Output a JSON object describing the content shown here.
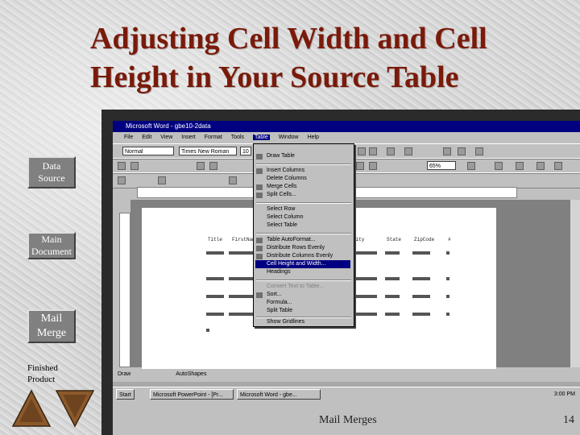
{
  "slide": {
    "title_line1": "Adjusting Cell Width and Cell",
    "title_line2": "Height in Your Source Table",
    "footer": "Mail Merges",
    "page_number": "14"
  },
  "nav": {
    "data_source": "Data Source",
    "main_document": "Main Document",
    "mail_merge": "Mail Merge",
    "finished_product": "Finished Product"
  },
  "word": {
    "window_title": "Microsoft Word - gbe10-2data",
    "menu": [
      "File",
      "Edit",
      "View",
      "Insert",
      "Format",
      "Tools",
      "Table",
      "Window",
      "Help"
    ],
    "style_box": "Normal",
    "font_box": "Times New Roman",
    "size_box": "10",
    "zoom_box": "65%",
    "table_menu": [
      "Draw Table",
      "Insert Columns",
      "Delete Columns",
      "Merge Cells",
      "Split Cells...",
      "Select Row",
      "Select Column",
      "Select Table",
      "Table AutoFormat...",
      "Distribute Rows Evenly",
      "Distribute Columns Evenly",
      "Cell Height and Width...",
      "Headings",
      "Convert Text to Table...",
      "Sort...",
      "Formula...",
      "Split Table",
      "Show Gridlines"
    ],
    "table_headers": [
      "Title",
      "FirstName",
      "City",
      "State",
      "ZipCode",
      "#"
    ],
    "draw_label": "Draw",
    "autoshapes_label": "AutoShapes",
    "start_label": "Start",
    "task_items": [
      "Microsoft PowerPoint - [Pr...",
      "Microsoft Word - gbe..."
    ],
    "clock": "3:00 PM"
  },
  "colors": {
    "title": "#7a1a0a",
    "nav_box": "#808080",
    "titlebar": "#000080",
    "arrow": "#8b5a2b"
  }
}
